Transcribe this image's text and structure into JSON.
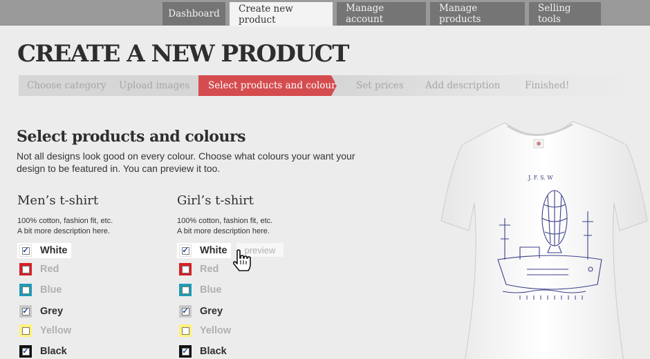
{
  "nav": {
    "tabs": [
      {
        "label": "Dashboard",
        "active": false
      },
      {
        "label": "Create new product",
        "active": true
      },
      {
        "label": "Manage account",
        "active": false
      },
      {
        "label": "Manage products",
        "active": false
      },
      {
        "label": "Selling tools",
        "active": false
      }
    ]
  },
  "page": {
    "title": "CREATE A NEW PRODUCT"
  },
  "steps": [
    {
      "label": "Choose category",
      "active": false
    },
    {
      "label": "Upload images",
      "active": false
    },
    {
      "label": "Select products and colours",
      "active": true
    },
    {
      "label": "Set prices",
      "active": false
    },
    {
      "label": "Add description",
      "active": false
    },
    {
      "label": "Finished!",
      "active": false
    }
  ],
  "section": {
    "title": "Select products and colours",
    "description": "Not all designs look good on every colour.  Choose what colours your want your design to be featured in.  You can preview it too."
  },
  "products": {
    "men": {
      "title": "Men’s t-shirt",
      "desc1": "100% cotton, fashion fit, etc.",
      "desc2": "A bit more description here.",
      "colours": [
        {
          "name": "White",
          "checked": true,
          "swatch": "#ffffff"
        },
        {
          "name": "Red",
          "checked": false,
          "swatch": "#d42026"
        },
        {
          "name": "Blue",
          "checked": false,
          "swatch": "#1f9bb5"
        },
        {
          "name": "Grey",
          "checked": true,
          "swatch": "#c9c9c9"
        },
        {
          "name": "Yellow",
          "checked": false,
          "swatch": "#fff27a"
        },
        {
          "name": "Black",
          "checked": true,
          "swatch": "#111111"
        }
      ]
    },
    "girl": {
      "title": "Girl’s t-shirt",
      "desc1": "100% cotton, fashion fit, etc.",
      "desc2": "A bit more description here.",
      "preview_label": "preview",
      "colours": [
        {
          "name": "White",
          "checked": true,
          "swatch": "#ffffff"
        },
        {
          "name": "Red",
          "checked": false,
          "swatch": "#d42026"
        },
        {
          "name": "Blue",
          "checked": false,
          "swatch": "#1f9bb5"
        },
        {
          "name": "Grey",
          "checked": true,
          "swatch": "#c9c9c9"
        },
        {
          "name": "Yellow",
          "checked": false,
          "swatch": "#fff27a"
        },
        {
          "name": "Black",
          "checked": true,
          "swatch": "#111111"
        }
      ]
    }
  },
  "shirt_design_text": "J. F. S. W",
  "colors": {
    "accent": "#d54c4f",
    "nav_bg": "#9a9a9a",
    "tab_bg": "#757575",
    "check": "#1f3b99"
  }
}
